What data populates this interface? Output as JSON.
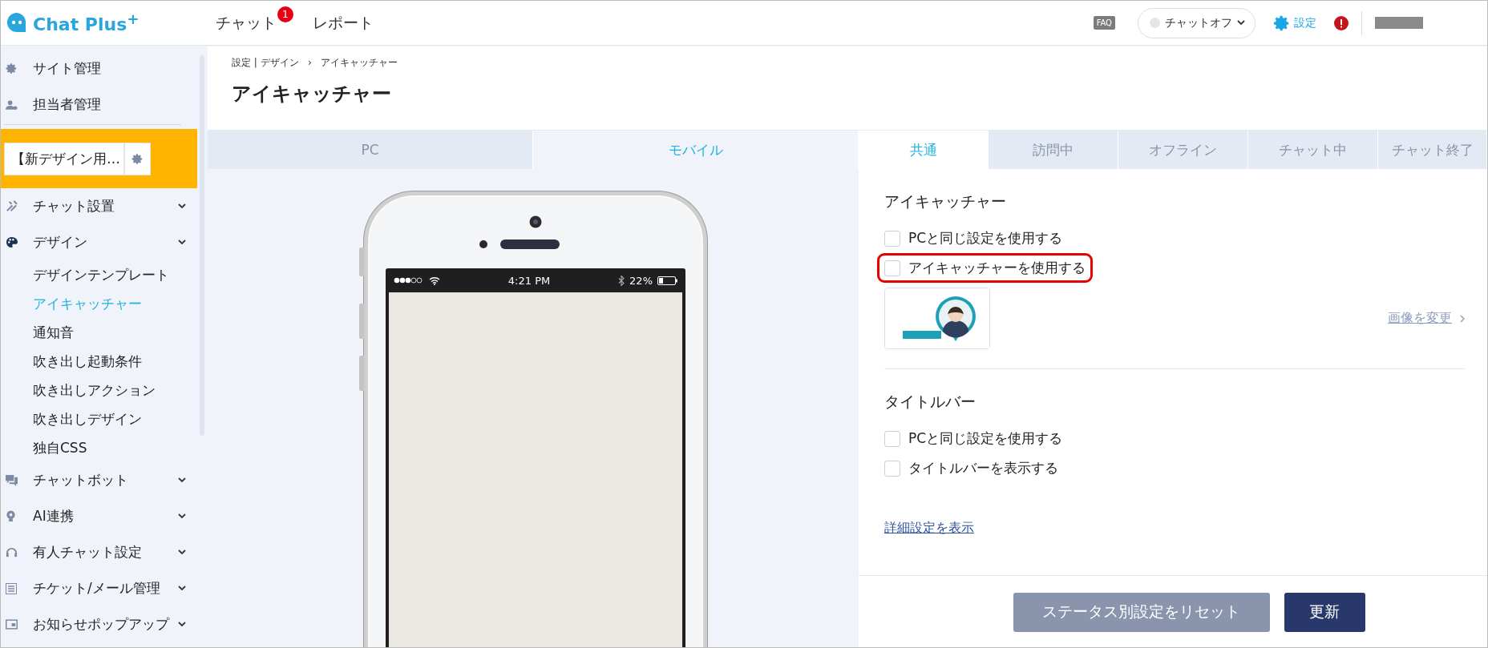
{
  "header": {
    "logo": "Chat Plus$^{+}$",
    "nav": [
      {
        "label": "チャット",
        "badge": "1"
      },
      {
        "label": "レポート"
      }
    ],
    "faq": "FAQ",
    "status_select": {
      "value": "チャットオフ"
    },
    "settings": "設定"
  },
  "sidebar": {
    "top_items": [
      {
        "label": "サイト管理"
      },
      {
        "label": "担当者管理"
      }
    ],
    "site_select": {
      "value": "【新デザイン用…"
    },
    "menu": [
      {
        "label": "チャット設置"
      },
      {
        "label": "デザイン",
        "children": [
          {
            "label": "デザインテンプレート",
            "selected": false
          },
          {
            "label": "アイキャッチャー",
            "selected": true
          },
          {
            "label": "通知音",
            "selected": false
          },
          {
            "label": "吹き出し起動条件",
            "selected": false
          },
          {
            "label": "吹き出しアクション",
            "selected": false
          },
          {
            "label": "吹き出しデザイン",
            "selected": false
          },
          {
            "label": "独自CSS",
            "selected": false
          }
        ]
      },
      {
        "label": "チャットボット"
      },
      {
        "label": "AI連携"
      },
      {
        "label": "有人チャット設定"
      },
      {
        "label": "チケット/メール管理"
      },
      {
        "label": "お知らせポップアップ"
      }
    ]
  },
  "breadcrumb": "設定 | デザイン   ›   アイキャッチャー",
  "title": "アイキャッチャー",
  "device_tabs": [
    {
      "label": "PC",
      "selected": false
    },
    {
      "label": "モバイル",
      "selected": true
    }
  ],
  "phone": {
    "time": "4:21 PM",
    "battery": "22%"
  },
  "status_tabs": [
    {
      "label": "共通",
      "selected": true
    },
    {
      "label": "訪問中",
      "selected": false
    },
    {
      "label": "オフライン",
      "selected": false
    },
    {
      "label": "チャット中",
      "selected": false
    },
    {
      "label": "チャット終了",
      "selected": false
    }
  ],
  "sections": [
    {
      "heading": "アイキャッチャー",
      "options": [
        {
          "label": "PCと同じ設定を使用する",
          "checked": false,
          "highlighted": false
        },
        {
          "label": "アイキャッチャーを使用する",
          "checked": false,
          "highlighted": true
        }
      ],
      "image": {
        "kind": "picture",
        "link": "画像を変更"
      }
    },
    {
      "heading": "タイトルバー",
      "options": [
        {
          "label": "PCと同じ設定を使用する",
          "checked": false,
          "highlighted": false
        },
        {
          "label": "タイトルバーを表示する",
          "checked": false,
          "highlighted": false
        }
      ]
    }
  ],
  "detail_link": "詳細設定を表示",
  "buttons": [
    {
      "label": "ステータス別設定をリセット",
      "kind": "secondary"
    },
    {
      "label": "更新",
      "kind": "primary"
    }
  ]
}
